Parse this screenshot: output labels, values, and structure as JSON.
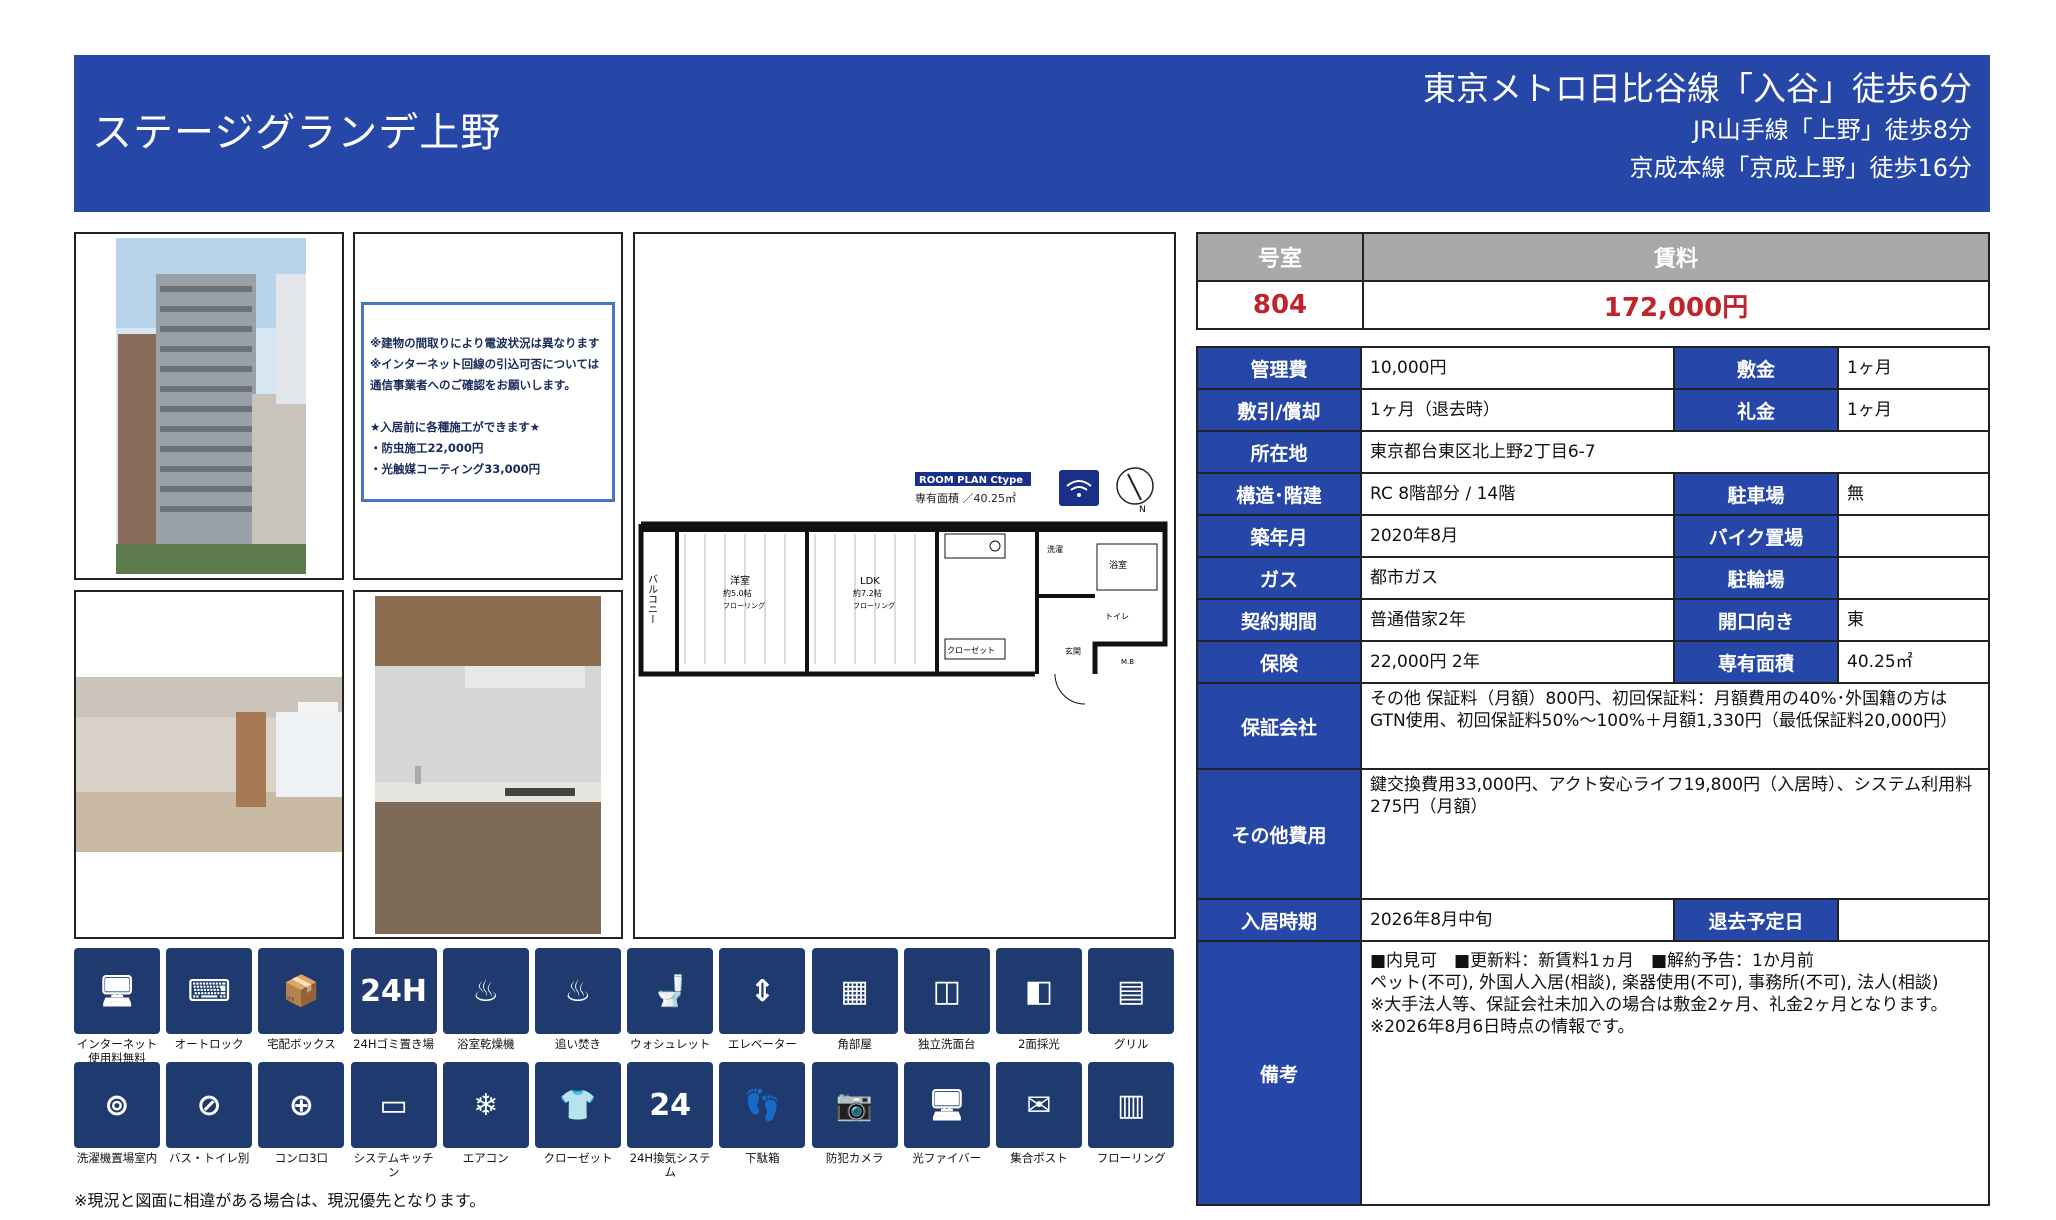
{
  "header": {
    "title": "ステージグランデ上野",
    "station1": "東京メトロ日比谷線「入谷」徒歩6分",
    "station2": "JR山手線「上野」徒歩8分",
    "station3": "京成本線「京成上野」徒歩16分"
  },
  "notice": {
    "lines": [
      "※建物の間取りにより電波状況は異なります",
      "※インターネット回線の引込可否については",
      "通信事業者へのご確認をお願いします。",
      "",
      "★入居前に各種施工ができます★",
      "・防虫施工22,000円",
      "・光触媒コーティング33,000円"
    ]
  },
  "floorplan": {
    "badge": "ROOM PLAN  Ctype",
    "area": "専有面積 ／40.25㎡",
    "balcony": "バルコニー",
    "room1": "洋室",
    "room1_size": "約5.0帖",
    "room1_floor": "フローリング",
    "room2": "LDK",
    "room2_size": "約7.2帖",
    "room2_floor": "フローリング",
    "closet": "クローゼット",
    "laundry": "洗濯",
    "bath": "浴室",
    "toilet": "トイレ",
    "entrance": "玄関",
    "storage": "M.B",
    "north": "N"
  },
  "amenities": [
    {
      "icon": "internet-icon",
      "label": "インターネット\n使用料無料"
    },
    {
      "icon": "autolock-icon",
      "label": "オートロック"
    },
    {
      "icon": "delivery-box-icon",
      "label": "宅配ボックス"
    },
    {
      "icon": "24h-garbage-icon",
      "label": "24Hゴミ置き場"
    },
    {
      "icon": "bath-dryer-icon",
      "label": "浴室乾燥機"
    },
    {
      "icon": "reheat-bath-icon",
      "label": "追い焚き"
    },
    {
      "icon": "washlet-icon",
      "label": "ウォシュレット"
    },
    {
      "icon": "elevator-icon",
      "label": "エレベーター"
    },
    {
      "icon": "corner-room-icon",
      "label": "角部屋"
    },
    {
      "icon": "vanity-icon",
      "label": "独立洗面台"
    },
    {
      "icon": "two-side-light-icon",
      "label": "2面採光"
    },
    {
      "icon": "grill-icon",
      "label": "グリル"
    },
    {
      "icon": "indoor-laundry-icon",
      "label": "洗濯機置場室内"
    },
    {
      "icon": "separate-bath-toilet-icon",
      "label": "バス・トイレ別"
    },
    {
      "icon": "three-burner-icon",
      "label": "コンロ3口"
    },
    {
      "icon": "system-kitchen-icon",
      "label": "システムキッチン"
    },
    {
      "icon": "air-conditioner-icon",
      "label": "エアコン"
    },
    {
      "icon": "closet-icon",
      "label": "クローゼット"
    },
    {
      "icon": "24h-ventilation-icon",
      "label": "24H換気システム"
    },
    {
      "icon": "shoe-box-icon",
      "label": "下駄箱"
    },
    {
      "icon": "security-camera-icon",
      "label": "防犯カメラ"
    },
    {
      "icon": "fiber-icon",
      "label": "光ファイバー"
    },
    {
      "icon": "mailbox-icon",
      "label": "集合ポスト"
    },
    {
      "icon": "flooring-icon",
      "label": "フローリング"
    }
  ],
  "footnote": "※現況と図面に相違がある場合は、現況優先となります。",
  "summary": {
    "room_label": "号室",
    "rent_label": "賃料",
    "room": "804",
    "rent": "172,000円"
  },
  "details": {
    "mgmt_label": "管理費",
    "mgmt": "10,000円",
    "deposit_label": "敷金",
    "deposit": "1ヶ月",
    "amort_label": "敷引/償却",
    "amort": "1ヶ月（退去時）",
    "keymoney_label": "礼金",
    "keymoney": "1ヶ月",
    "address_label": "所在地",
    "address": "東京都台東区北上野2丁目6-7",
    "structure_label": "構造･階建",
    "structure": "RC 8階部分 / 14階",
    "parking_label": "駐車場",
    "parking": "無",
    "built_label": "築年月",
    "built": "2020年8月",
    "bike_label": "バイク置場",
    "bike": "",
    "gas_label": "ガス",
    "gas": "都市ガス",
    "bicycle_label": "駐輪場",
    "bicycle": "",
    "contract_label": "契約期間",
    "contract": "普通借家2年",
    "direction_label": "開口向き",
    "direction": "東",
    "insurance_label": "保険",
    "insurance": "22,000円 2年",
    "area_label": "専有面積",
    "area": "40.25㎡",
    "guarantor_label": "保証会社",
    "guarantor": "その他 保証料（月額）800円、初回保証料：月額費用の40%･外国籍の方はGTN使用、初回保証料50%～100%＋月額1,330円（最低保証料20,000円）",
    "other_label": "その他費用",
    "other": "鍵交換費用33,000円、アクト安心ライフ19,800円（入居時）、システム利用料275円（月額）",
    "movein_label": "入居時期",
    "movein": "2026年8月中旬",
    "moveout_label": "退去予定日",
    "moveout": "",
    "remarks_label": "備考",
    "remarks1": "■内見可　■更新料：新賃料1ヵ月　■解約予告：1か月前",
    "remarks2": "ペット(不可), 外国人入居(相談), 楽器使用(不可), 事務所(不可), 法人(相談)",
    "remarks3": "※大手法人等、保証会社未加入の場合は敷金2ヶ月、礼金2ヶ月となります。",
    "remarks4": "※2026年8月6日時点の情報です。"
  },
  "colors": {
    "header_bg": "#2647a8",
    "rent_red": "#c0232b",
    "icon_bg": "#1f3a6e"
  }
}
